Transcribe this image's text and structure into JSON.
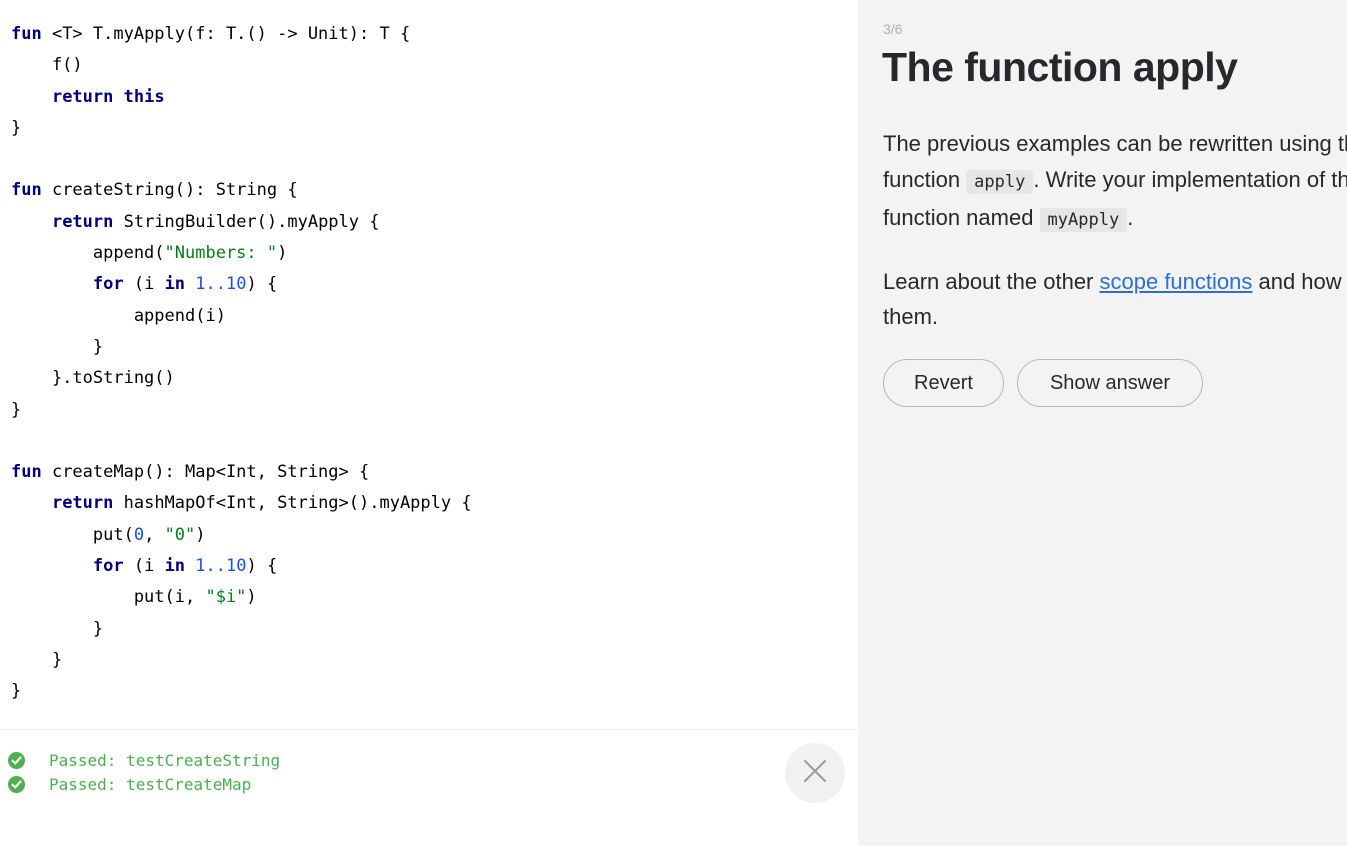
{
  "editor": {
    "lines": [
      [
        {
          "t": "fun",
          "c": "kw"
        },
        {
          "t": " <T> T.myApply(f: T.() -> Unit): T {"
        }
      ],
      [
        {
          "t": "    f()"
        }
      ],
      [
        {
          "t": "    "
        },
        {
          "t": "return",
          "c": "kw"
        },
        {
          "t": " "
        },
        {
          "t": "this",
          "c": "kw"
        }
      ],
      [
        {
          "t": "}"
        }
      ],
      [],
      [
        {
          "t": "fun",
          "c": "kw"
        },
        {
          "t": " createString(): String {"
        }
      ],
      [
        {
          "t": "    "
        },
        {
          "t": "return",
          "c": "kw"
        },
        {
          "t": " StringBuilder().myApply {"
        }
      ],
      [
        {
          "t": "        append("
        },
        {
          "t": "\"Numbers: \"",
          "c": "str"
        },
        {
          "t": ")"
        }
      ],
      [
        {
          "t": "        "
        },
        {
          "t": "for",
          "c": "kw"
        },
        {
          "t": " (i "
        },
        {
          "t": "in",
          "c": "kw"
        },
        {
          "t": " "
        },
        {
          "t": "1..10",
          "c": "num"
        },
        {
          "t": ") {"
        }
      ],
      [
        {
          "t": "            append(i)"
        }
      ],
      [
        {
          "t": "        }"
        }
      ],
      [
        {
          "t": "    }.toString()"
        }
      ],
      [
        {
          "t": "}"
        }
      ],
      [],
      [
        {
          "t": "fun",
          "c": "kw"
        },
        {
          "t": " createMap(): Map<Int, String> {"
        }
      ],
      [
        {
          "t": "    "
        },
        {
          "t": "return",
          "c": "kw"
        },
        {
          "t": " hashMapOf<Int, String>().myApply {"
        }
      ],
      [
        {
          "t": "        put("
        },
        {
          "t": "0",
          "c": "num"
        },
        {
          "t": ", "
        },
        {
          "t": "\"0\"",
          "c": "str"
        },
        {
          "t": ")"
        }
      ],
      [
        {
          "t": "        "
        },
        {
          "t": "for",
          "c": "kw"
        },
        {
          "t": " (i "
        },
        {
          "t": "in",
          "c": "kw"
        },
        {
          "t": " "
        },
        {
          "t": "1..10",
          "c": "num"
        },
        {
          "t": ") {"
        }
      ],
      [
        {
          "t": "            put(i, "
        },
        {
          "t": "\"$i\"",
          "c": "str"
        },
        {
          "t": ")"
        }
      ],
      [
        {
          "t": "        }"
        }
      ],
      [
        {
          "t": "    }"
        }
      ],
      [
        {
          "t": "}"
        }
      ]
    ]
  },
  "output": {
    "results": [
      {
        "label": "Passed: testCreateString",
        "status": "passed"
      },
      {
        "label": "Passed: testCreateMap",
        "status": "passed"
      }
    ],
    "close_icon": "close-icon"
  },
  "task": {
    "step": "3/6",
    "title": "The function apply",
    "paragraph1": {
      "before": "The previous examples can be rewritten using the library function ",
      "code1": "apply",
      "middle": ". Write your implementation of this function named ",
      "code2": "myApply",
      "after": "."
    },
    "paragraph2": {
      "before": "Learn about the other ",
      "link": "scope functions",
      "after": " and how to use them."
    },
    "buttons": {
      "revert": "Revert",
      "show_answer": "Show answer"
    }
  },
  "colors": {
    "keyword": "#000080",
    "string": "#067d17",
    "number": "#1750eb",
    "passed": "#4caf50",
    "link": "#2a6fd9",
    "panel_bg": "#f3f3f3"
  }
}
